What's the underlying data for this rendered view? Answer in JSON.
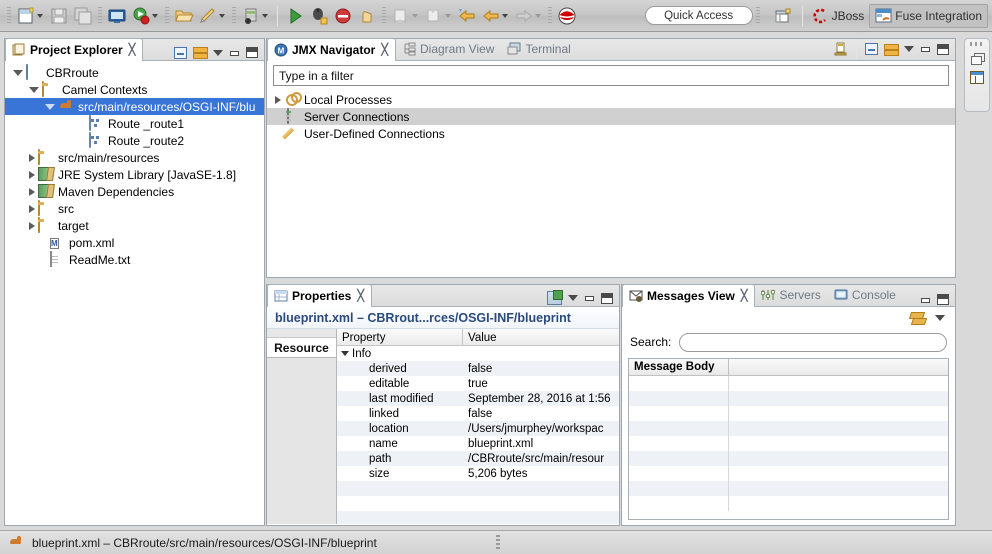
{
  "toolbar": {
    "items": [
      {
        "name": "new-wizard-button",
        "icon": "new-file-icon",
        "dropdown": true
      },
      {
        "name": "save-button",
        "icon": "save-icon",
        "dropdown": false
      },
      {
        "name": "save-all-button",
        "icon": "save-all-icon",
        "dropdown": false
      },
      {
        "name": "new-server-button",
        "icon": "server-icon",
        "dropdown": false
      },
      {
        "name": "run-button",
        "icon": "run-icon",
        "dropdown": true
      },
      {
        "name": "open-type-button",
        "icon": "open-folder-icon",
        "dropdown": false
      },
      {
        "name": "quick-fix-button",
        "icon": "pencil-icon",
        "dropdown": true
      },
      {
        "name": "new-connection-button",
        "icon": "database-icon",
        "dropdown": true
      },
      {
        "name": "run-as-button",
        "icon": "run-green-icon",
        "dropdown": false
      },
      {
        "name": "debug-as-button",
        "icon": "debug-icon",
        "dropdown": false
      },
      {
        "name": "terminate-button",
        "icon": "stop-icon",
        "dropdown": false
      },
      {
        "name": "suspend-button",
        "icon": "suspend-icon",
        "dropdown": false
      },
      {
        "name": "next-annotation-button",
        "icon": "next-annotation-icon",
        "dropdown": true
      },
      {
        "name": "previous-annotation-button",
        "icon": "previous-annotation-icon",
        "dropdown": true
      },
      {
        "name": "back-button",
        "icon": "back-arrow-icon",
        "dropdown": false
      },
      {
        "name": "forward-back-button",
        "icon": "left-arrow-icon",
        "dropdown": true
      },
      {
        "name": "forward-button",
        "icon": "right-arrow-icon",
        "dropdown": true
      },
      {
        "name": "redhat-button",
        "icon": "redhat-logo-icon",
        "dropdown": false
      }
    ],
    "quick_access": "Quick Access",
    "perspectives": [
      {
        "name": "open-perspective-button",
        "label": "",
        "icon": "open-perspective-icon",
        "active": false
      },
      {
        "name": "perspective-jboss",
        "label": "JBoss",
        "icon": "jboss-logo-icon",
        "active": false
      },
      {
        "name": "perspective-fuse-integration",
        "label": "Fuse Integration",
        "icon": "fuse-icon",
        "active": true
      }
    ]
  },
  "project_explorer": {
    "tab_label": "Project Explorer",
    "tools": [
      "collapse-all-icon",
      "link-with-editor-icon",
      "view-menu-icon",
      "minimize-icon",
      "maximize-icon"
    ],
    "tree": [
      {
        "label": "CBRroute",
        "icon": "project-icon",
        "depth": 0,
        "state": "open",
        "selected": false
      },
      {
        "label": "Camel Contexts",
        "icon": "folder-open-icon",
        "depth": 1,
        "state": "open",
        "selected": false
      },
      {
        "label": "src/main/resources/OSGI-INF/blu",
        "icon": "camel-icon",
        "depth": 2,
        "state": "open",
        "selected": true
      },
      {
        "label": "Route _route1",
        "icon": "route-icon",
        "depth": 3,
        "state": "leaf",
        "selected": false
      },
      {
        "label": "Route _route2",
        "icon": "route-icon",
        "depth": 3,
        "state": "leaf",
        "selected": false
      },
      {
        "label": "src/main/resources",
        "icon": "package-icon",
        "depth": 1,
        "state": "closed",
        "selected": false
      },
      {
        "label": "JRE System Library [JavaSE-1.8]",
        "icon": "library-icon",
        "depth": 1,
        "state": "closed",
        "selected": false
      },
      {
        "label": "Maven Dependencies",
        "icon": "library-icon",
        "depth": 1,
        "state": "closed",
        "selected": false
      },
      {
        "label": "src",
        "icon": "folder-icon",
        "depth": 1,
        "state": "closed",
        "selected": false
      },
      {
        "label": "target",
        "icon": "folder-icon",
        "depth": 1,
        "state": "closed",
        "selected": false
      },
      {
        "label": "pom.xml",
        "icon": "maven-xml-icon",
        "depth": 1,
        "state": "leaf",
        "selected": false
      },
      {
        "label": "ReadMe.txt",
        "icon": "text-file-icon",
        "depth": 1,
        "state": "leaf",
        "selected": false
      }
    ]
  },
  "jmx_navigator": {
    "tabs": [
      {
        "label": "JMX Navigator",
        "icon": "jmx-icon",
        "active": true,
        "closable": true
      },
      {
        "label": "Diagram View",
        "icon": "diagram-icon",
        "active": false,
        "closable": false
      },
      {
        "label": "Terminal",
        "icon": "terminal-icon",
        "active": false,
        "closable": false
      }
    ],
    "filter_value": "Type in a filter",
    "tree": [
      {
        "label": "Local Processes",
        "icon": "gear-icon",
        "state": "closed",
        "selected": false
      },
      {
        "label": "Server Connections",
        "icon": "server-icon",
        "state": "leaf",
        "selected": true
      },
      {
        "label": "User-Defined Connections",
        "icon": "pencil-icon",
        "state": "leaf",
        "selected": false
      }
    ]
  },
  "properties_view": {
    "tab_label": "Properties",
    "title": "blueprint.xml – CBRrout...rces/OSGI-INF/blueprint",
    "side_tabs": [
      "Resource"
    ],
    "columns": [
      "Property",
      "Value"
    ],
    "rows": [
      {
        "property": "Info",
        "value": "",
        "group": true
      },
      {
        "property": "derived",
        "value": "false",
        "group": false
      },
      {
        "property": "editable",
        "value": "true",
        "group": false
      },
      {
        "property": "last modified",
        "value": "September 28, 2016 at 1:56",
        "group": false
      },
      {
        "property": "linked",
        "value": "false",
        "group": false
      },
      {
        "property": "location",
        "value": "/Users/jmurphey/workspac",
        "group": false
      },
      {
        "property": "name",
        "value": "blueprint.xml",
        "group": false
      },
      {
        "property": "path",
        "value": "/CBRroute/src/main/resour",
        "group": false
      },
      {
        "property": "size",
        "value": "5,206  bytes",
        "group": false
      }
    ]
  },
  "messages_view": {
    "tabs": [
      {
        "label": "Messages View",
        "icon": "messages-icon",
        "active": true,
        "closable": true
      },
      {
        "label": "Servers",
        "icon": "servers-icon",
        "active": false,
        "closable": false
      },
      {
        "label": "Console",
        "icon": "console-icon",
        "active": false,
        "closable": false
      }
    ],
    "search_label": "Search:",
    "search_value": "",
    "columns": [
      "Message Body",
      ""
    ],
    "row_count": 9
  },
  "minimized_bar": {
    "restore_label": "restore-icon",
    "view_label": "view-icon"
  },
  "statusbar": {
    "icon": "camel-icon",
    "text": "blueprint.xml – CBRroute/src/main/resources/OSGI-INF/blueprint"
  },
  "colors": {
    "selection_blue": "#3875d7",
    "title_blue": "#2b4a7d",
    "tab_inactive": "#6f7a86",
    "accent_orange": "#cf7b2f"
  }
}
